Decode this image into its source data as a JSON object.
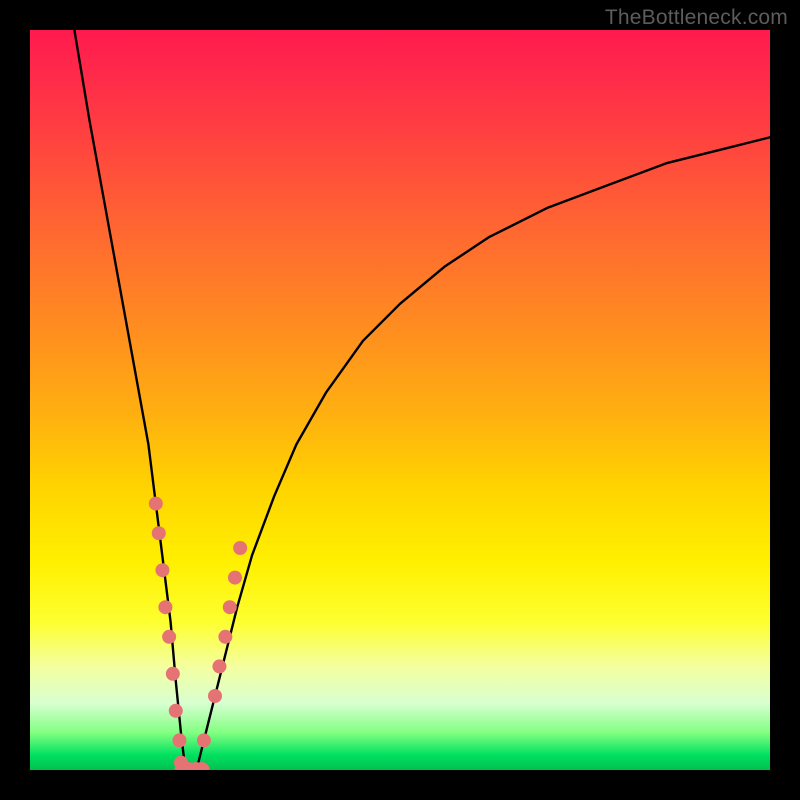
{
  "watermark": "TheBottleneck.com",
  "colors": {
    "frame": "#000000",
    "stroke": "#000000",
    "marker": "#e57373",
    "gradient_top": "#ff1a4d",
    "gradient_bottom": "#00c050"
  },
  "chart_data": {
    "type": "line",
    "title": "",
    "xlabel": "",
    "ylabel": "",
    "xlim": [
      0,
      100
    ],
    "ylim": [
      0,
      100
    ],
    "grid": false,
    "legend": false,
    "series": [
      {
        "name": "curve",
        "x": [
          6,
          8,
          10,
          12,
          14,
          16,
          17,
          18,
          19,
          19.7,
          20.4,
          21,
          22.5,
          24,
          26,
          28,
          30,
          33,
          36,
          40,
          45,
          50,
          56,
          62,
          70,
          78,
          86,
          94,
          100
        ],
        "values": [
          100,
          88,
          77,
          66,
          55,
          44,
          36,
          28,
          20,
          12,
          5,
          0,
          0,
          6,
          14,
          22,
          29,
          37,
          44,
          51,
          58,
          63,
          68,
          72,
          76,
          79,
          82,
          84,
          85.5
        ]
      }
    ],
    "markers": {
      "left_branch": {
        "x": [
          17.0,
          17.4,
          17.9,
          18.3,
          18.8,
          19.3,
          19.7,
          20.2,
          20.4
        ],
        "values": [
          36,
          32,
          27,
          22,
          18,
          13,
          8,
          4,
          1
        ]
      },
      "right_branch": {
        "x": [
          23.5,
          25.0,
          25.6,
          26.4,
          27.0,
          27.7,
          28.4
        ],
        "values": [
          4,
          10,
          14,
          18,
          22,
          26,
          30
        ]
      },
      "bottom": {
        "x": [
          20.6,
          21.4,
          22.4,
          23.2
        ],
        "values": [
          0,
          0,
          0,
          0
        ]
      }
    }
  }
}
